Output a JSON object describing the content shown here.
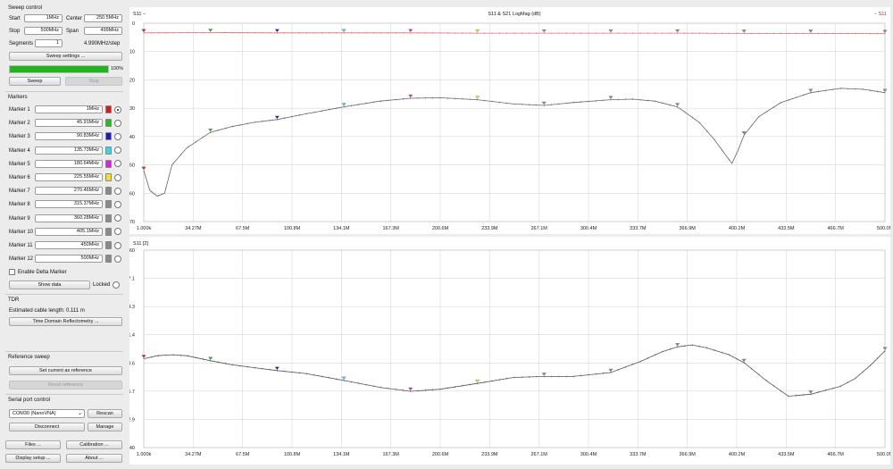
{
  "sweep": {
    "title": "Sweep control",
    "start_label": "Start",
    "start_value": "1MHz",
    "center_label": "Center",
    "center_value": "250.5MHz",
    "stop_label": "Stop",
    "stop_value": "500MHz",
    "span_label": "Span",
    "span_value": "499MHz",
    "segments_label": "Segments",
    "segments_value": "1",
    "step_text": "4.990MHz/step",
    "settings_button": "Sweep settings ...",
    "progress_percent": 100,
    "progress_text": "100%",
    "sweep_button": "Sweep",
    "stop_button": "Stop"
  },
  "markers": {
    "title": "Markers",
    "items": [
      {
        "label": "Marker 1",
        "value": "1MHz",
        "color": "#e01818",
        "selected": true
      },
      {
        "label": "Marker 2",
        "value": "45.91MHz",
        "color": "#20c020",
        "selected": false
      },
      {
        "label": "Marker 3",
        "value": "90.83MHz",
        "color": "#1a1ac8",
        "selected": false
      },
      {
        "label": "Marker 4",
        "value": "135.73MHz",
        "color": "#30d8e8",
        "selected": false
      },
      {
        "label": "Marker 5",
        "value": "180.64MHz",
        "color": "#e020e0",
        "selected": false
      },
      {
        "label": "Marker 6",
        "value": "225.55MHz",
        "color": "#f0e020",
        "selected": false
      },
      {
        "label": "Marker 7",
        "value": "270.46MHz",
        "color": "#8a8a8a",
        "selected": false
      },
      {
        "label": "Marker 8",
        "value": "315.37MHz",
        "color": "#8a8a8a",
        "selected": false
      },
      {
        "label": "Marker 9",
        "value": "360.28MHz",
        "color": "#8a8a8a",
        "selected": false
      },
      {
        "label": "Marker 10",
        "value": "405.1MHz",
        "color": "#8a8a8a",
        "selected": false
      },
      {
        "label": "Marker 11",
        "value": "450MHz",
        "color": "#8a8a8a",
        "selected": false
      },
      {
        "label": "Marker 12",
        "value": "500MHz",
        "color": "#8a8a8a",
        "selected": false
      }
    ],
    "delta_label": "Enable Delta Marker",
    "show_data_button": "Show data",
    "locked_label": "Locked"
  },
  "tdr": {
    "title": "TDR",
    "cable_text": "Estimated cable length: 0.111 m",
    "button": "Time Domain Reflectometry ..."
  },
  "reference": {
    "title": "Reference sweep",
    "set_button": "Set current as reference",
    "reset_button": "Reset reference"
  },
  "serial": {
    "title": "Serial port control",
    "port_value": "COM30 (NanoVNA)",
    "rescan_button": "Rescan",
    "disconnect_button": "Disconnect",
    "manage_button": "Manage"
  },
  "bottom_buttons": {
    "files": "Files ...",
    "calibration": "Calibration ...",
    "display": "Display setup ...",
    "about": "About ..."
  },
  "chart_data": [
    {
      "type": "line",
      "corner_label": "S11 −",
      "title": "S11 & S21 LogMag (dB)",
      "legend": "− S11",
      "xlabel": "",
      "ylabel": "",
      "xlim": [
        1,
        500
      ],
      "ylim": [
        -70,
        0
      ],
      "y_ticks": [
        "0",
        "-10",
        "-20",
        "-30",
        "-40",
        "-50",
        "-60",
        "-70"
      ],
      "x_ticks": [
        "1.000k",
        "34.27M",
        "67.5M",
        "100.8M",
        "134.1M",
        "167.3M",
        "200.6M",
        "233.9M",
        "267.1M",
        "300.4M",
        "333.7M",
        "366.9M",
        "400.2M",
        "433.5M",
        "466.7M",
        "500.0M"
      ],
      "series": [
        {
          "color": "#e07070",
          "x": [
            1,
            45.9,
            90.8,
            135.7,
            180.6,
            225.6,
            270.5,
            315.4,
            360.3,
            405.1,
            450,
            500
          ],
          "y": [
            -3.4,
            -3.3,
            -3.4,
            -3.4,
            -3.4,
            -3.5,
            -3.5,
            -3.5,
            -3.5,
            -3.6,
            -3.6,
            -3.7
          ]
        },
        {
          "color": "#666666",
          "x": [
            1,
            5,
            10,
            15,
            20,
            30,
            45.9,
            60,
            75,
            90.8,
            110,
            135.7,
            160,
            180.6,
            200,
            225.6,
            250,
            270.5,
            290,
            315.4,
            330,
            345,
            360.3,
            375,
            385,
            392,
            397,
            401,
            405.1,
            415,
            430,
            450,
            470,
            485,
            500
          ],
          "y": [
            -52,
            -59,
            -61,
            -60,
            -50,
            -44,
            -38.5,
            -36.5,
            -35,
            -34,
            -32,
            -29.5,
            -27.5,
            -26.5,
            -26.3,
            -27,
            -28.5,
            -29,
            -28,
            -27,
            -26.8,
            -27.5,
            -29.5,
            -35,
            -41,
            -46,
            -49.5,
            -45,
            -39.5,
            -33,
            -28,
            -24.5,
            -23,
            -23.3,
            -24.5
          ]
        }
      ],
      "markers_x": [
        1,
        45.9,
        90.8,
        135.7,
        180.6,
        225.6,
        270.5,
        315.4,
        360.3,
        405.1,
        450,
        500
      ]
    },
    {
      "type": "line",
      "corner_label": "S11 [2]",
      "title": "",
      "xlabel": "",
      "ylabel": "",
      "xlim": [
        1,
        500
      ],
      "ylim": [
        40,
        60
      ],
      "y_ticks": [
        "60",
        "57.1",
        "54.3",
        "51.4",
        "48.6",
        "45.7",
        "42.9",
        "40"
      ],
      "x_ticks": [
        "1.000k",
        "34.27M",
        "67.5M",
        "100.8M",
        "134.1M",
        "167.3M",
        "200.6M",
        "233.9M",
        "267.1M",
        "300.4M",
        "333.7M",
        "366.9M",
        "400.2M",
        "433.5M",
        "466.7M",
        "500.0M"
      ],
      "series": [
        {
          "color": "#555555",
          "x": [
            1,
            10,
            20,
            30,
            45.9,
            60,
            75,
            90.8,
            110,
            135.7,
            160,
            180.6,
            200,
            225.6,
            250,
            270.5,
            290,
            315.4,
            335,
            350,
            360.3,
            370,
            380,
            395,
            405.1,
            420,
            435,
            450,
            460,
            470,
            480,
            490,
            500
          ],
          "y": [
            49.0,
            49.3,
            49.4,
            49.3,
            48.8,
            48.4,
            48.1,
            47.8,
            47.5,
            46.8,
            46.1,
            45.7,
            45.9,
            46.5,
            47.1,
            47.2,
            47.2,
            47.6,
            48.7,
            49.7,
            50.2,
            50.4,
            50.1,
            49.4,
            48.6,
            46.8,
            45.2,
            45.4,
            45.8,
            46.2,
            47.0,
            48.3,
            49.8
          ]
        }
      ],
      "markers_x": [
        1,
        45.9,
        90.8,
        135.7,
        180.6,
        225.6,
        270.5,
        315.4,
        360.3,
        405.1,
        450,
        500
      ]
    }
  ]
}
